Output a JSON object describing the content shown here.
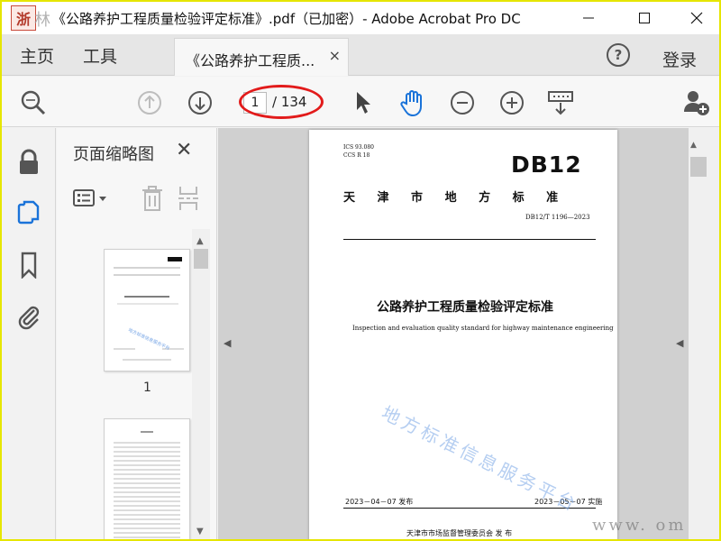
{
  "titlebar": {
    "logo_char": "浙",
    "logo_text": "林",
    "title": "《公路养护工程质量检验评定标准》.pdf（已加密）- Adobe Acrobat Pro DC",
    "minimize_icon": "minimize-icon",
    "maximize_icon": "maximize-icon",
    "close_icon": "close-icon"
  },
  "tabs": {
    "home": "主页",
    "tools": "工具",
    "doc_tab": "《公路养护工程质...",
    "doc_tab_close": "×",
    "help": "?",
    "login": "登录"
  },
  "toolbar": {
    "page_current": "1",
    "page_total": "/ 134"
  },
  "leftnav": {
    "items": [
      "lock-icon",
      "pages-icon",
      "bookmark-icon",
      "attachment-icon"
    ]
  },
  "thumbpanel": {
    "title": "页面缩略图",
    "close": "✕",
    "page1_label": "1"
  },
  "document": {
    "ics": "ICS  93.080",
    "ccs": "CCS  R  18",
    "db_code": "DB12",
    "region": "天 津 市 地 方 标 准",
    "std_no": "DB12/T 1196—2023",
    "title_cn": "公路养护工程质量检验评定标准",
    "title_en": "Inspection and evaluation quality standard for highway maintenance engineering",
    "publish_date": "2023－04－07 发布",
    "implement_date": "2023－05－07 实施",
    "issuer": "天津市市场监督管理委员会     发  布"
  },
  "watermarks": {
    "diagonal": "地方标准信息服务平台",
    "corner": "www.        om"
  },
  "colors": {
    "border_yellow": "#e6e600",
    "annotation_red": "#e21b1b",
    "hand_tool_blue": "#1a73d9"
  }
}
